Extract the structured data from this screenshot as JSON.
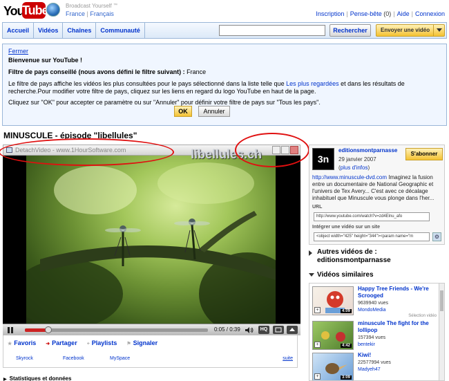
{
  "header": {
    "tagline": "Broadcast Yourself",
    "tagline_tm": "™",
    "logo_you": "You",
    "logo_tube": "Tube",
    "region": "France",
    "language": "Français",
    "region_sep": "|",
    "links": {
      "signup": "Inscription",
      "quicklist": "Pense-bête",
      "quicklist_count": "(0)",
      "help": "Aide",
      "login": "Connexion"
    }
  },
  "nav": {
    "tabs": [
      "Accueil",
      "Vidéos",
      "Chaînes",
      "Communauté"
    ],
    "search_value": "",
    "search_label": "Rechercher",
    "upload_label": "Envoyer une vidéo"
  },
  "notice": {
    "close_label": "Fermer",
    "title": "Bienvenue sur YouTube !",
    "filter_label": "Filtre de pays conseillé (nous avons défini le filtre suivant) :",
    "filter_value": "France",
    "para_part1": "Le filtre de pays affiche les vidéos les plus consultées pour le pays sélectionné dans la liste telle que",
    "para_link": "Les plus regardées",
    "para_part2": "et dans les résultats de recherche.Pour modifier votre filtre de pays, cliquez sur les liens en regard du logo YouTube en haut de la page.",
    "para2": "Cliquez sur \"OK\" pour accepter ce paramètre ou sur \"Annuler\" pour définir votre filtre de pays sur \"Tous les pays\".",
    "ok_label": "OK",
    "cancel_label": "Annuler"
  },
  "video": {
    "title": "MINUSCULE - épisode \"libellules\"",
    "detach_label": "DetachVideo - www.1HourSoftware.com",
    "overlay_title": "libellules.ch",
    "time": "0:05 / 0:39",
    "progress": 0.13,
    "hq_label": "HQ"
  },
  "actions": {
    "favorites": "Favoris",
    "share": "Partager",
    "playlists": "Playlists",
    "flag": "Signaler",
    "share_targets": [
      "Skyrock",
      "Facebook",
      "MySpace"
    ],
    "more": "suite"
  },
  "stats_label": "Statistiques et données",
  "channel": {
    "avatar_text": "3n",
    "uploader": "editionsmontparnasse",
    "date": "29 janvier 2007",
    "plus_info_open": "(",
    "plus_info_link": "plus d'infos",
    "plus_info_close": ")",
    "subscribe": "S'abonner",
    "desc_link": "http://www.minuscule-dvd.com",
    "desc_text": "Imaginez la fusion entre un documentaire de National Geographic et l'univers de Tex Avery... C'est avec ce décalage inhabituel que Minuscule vous plonge dans l'her...",
    "url_label": "URL",
    "url_value": "http://www.youtube.com/watch?v=zd4Elnu_afo",
    "embed_label": "Intégrer une vidéo sur un site",
    "embed_value": "<object width=\"425\" height=\"344\"><param name=\"m"
  },
  "more_videos_label": "Autres vidéos de : editionsmontparnasse",
  "related_label": "Vidéos similaires",
  "related": [
    {
      "title": "Happy Tree Friends - We're Scrooged",
      "views": "9639940 vues",
      "author": "MondoMedia",
      "duration": "4:09",
      "note": "Sélection vidéo",
      "theme": "red"
    },
    {
      "title": "minuscule The fight for the lollipop",
      "views": "157394 vues",
      "author": "bentekir",
      "duration": "4:42",
      "note": "",
      "theme": "green"
    },
    {
      "title": "Kiwi!",
      "views": "22577994 vues",
      "author": "Madyeh47",
      "duration": "3:09",
      "note": "",
      "theme": "blue"
    }
  ],
  "colors": {
    "link": "#0033cc",
    "accent_yellow": "#f4c232",
    "youtube_red": "#cc0000",
    "annotation_red": "#e01010"
  }
}
